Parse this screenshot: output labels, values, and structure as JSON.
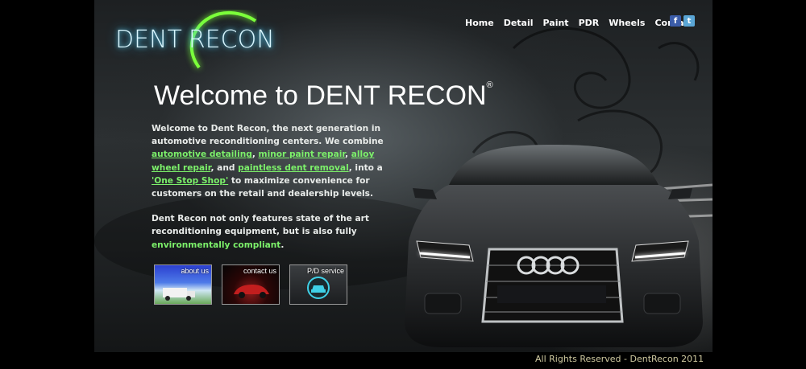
{
  "logo": {
    "text_left": "DENT",
    "text_right": "RECON"
  },
  "nav": [
    {
      "label": "Home"
    },
    {
      "label": "Detail"
    },
    {
      "label": "Paint"
    },
    {
      "label": "PDR"
    },
    {
      "label": "Wheels"
    },
    {
      "label": "Contact"
    }
  ],
  "social": {
    "facebook": "f",
    "twitter": "t"
  },
  "heading": {
    "text": "Welcome to DENT RECON",
    "mark": "®"
  },
  "intro": {
    "p1_a": "Welcome to Dent Recon, the next generation in automotive reconditioning centers. We combine ",
    "link1": "automotive detailing",
    "sep1": ", ",
    "link2": "minor paint repair",
    "sep2": ", ",
    "link3": "alloy wheel repair",
    "p1_b": ", and ",
    "link4": "paintless dent removal",
    "p1_c": ", into a ",
    "link5": "'One Stop Shop'",
    "p1_d": " to maximize convenience for customers on the retail and dealership levels.",
    "p2_a": "Dent Recon not only features state of the art reconditioning equipment, but is also fully ",
    "p2_hl": "environmentally compliant",
    "p2_b": "."
  },
  "thumbs": [
    {
      "label": "about us"
    },
    {
      "label": "contact us"
    },
    {
      "label": "P/D service"
    }
  ],
  "footer": {
    "text": "All Rights Reserved - DentRecon 2011"
  },
  "colors": {
    "link_green": "#7cf06a",
    "logo_glow": "#5fd9ff",
    "logo_arc": "#7cff3a"
  }
}
